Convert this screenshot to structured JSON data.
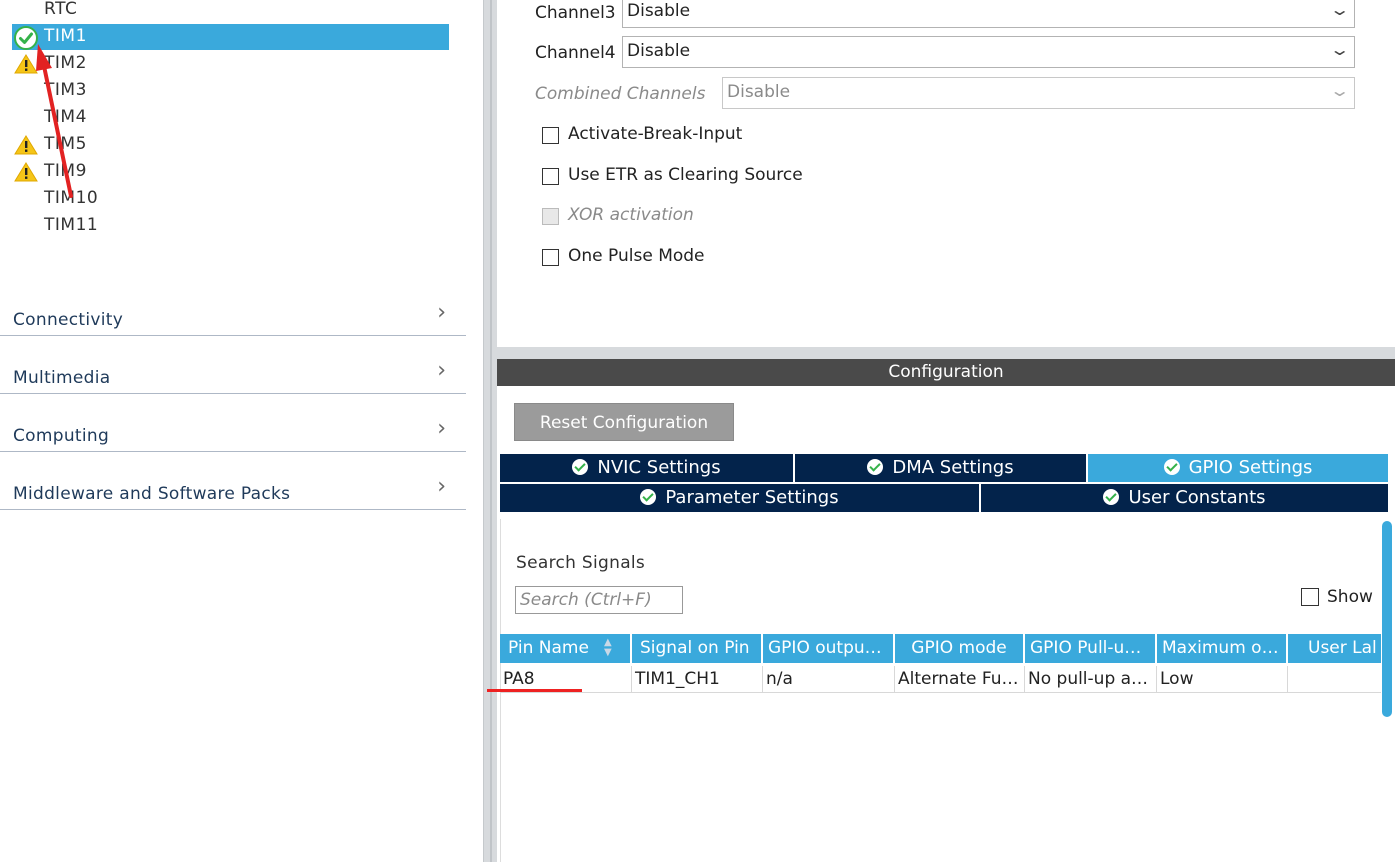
{
  "left_panel": {
    "timers": [
      {
        "label": "RTC",
        "status": "none"
      },
      {
        "label": "TIM1",
        "status": "ok",
        "selected": true
      },
      {
        "label": "TIM2",
        "status": "warning"
      },
      {
        "label": "TIM3",
        "status": "none"
      },
      {
        "label": "TIM4",
        "status": "none"
      },
      {
        "label": "TIM5",
        "status": "warning"
      },
      {
        "label": "TIM9",
        "status": "warning"
      },
      {
        "label": "TIM10",
        "status": "none"
      },
      {
        "label": "TIM11",
        "status": "none"
      }
    ],
    "categories": [
      {
        "label": "Connectivity",
        "icon": "chevron-right-icon"
      },
      {
        "label": "Multimedia",
        "icon": "chevron-right-icon"
      },
      {
        "label": "Computing",
        "icon": "chevron-right-icon"
      },
      {
        "label": "Middleware and Software Packs",
        "icon": "chevron-right-icon"
      }
    ]
  },
  "mode": {
    "channel3": {
      "label": "Channel3",
      "value": "Disable"
    },
    "channel4": {
      "label": "Channel4",
      "value": "Disable"
    },
    "combined": {
      "label": "Combined Channels",
      "value": "Disable",
      "disabled": true
    },
    "checkboxes": [
      {
        "label": "Activate-Break-Input",
        "checked": false,
        "disabled": false
      },
      {
        "label": "Use ETR as Clearing Source",
        "checked": false,
        "disabled": false
      },
      {
        "label": "XOR activation",
        "checked": false,
        "disabled": true
      },
      {
        "label": "One Pulse Mode",
        "checked": false,
        "disabled": false
      }
    ]
  },
  "configuration": {
    "title": "Configuration",
    "reset_button": "Reset Configuration",
    "tabs_row1": [
      {
        "label": "NVIC Settings",
        "active": false
      },
      {
        "label": "DMA Settings",
        "active": false
      },
      {
        "label": "GPIO Settings",
        "active": true
      }
    ],
    "tabs_row2": [
      {
        "label": "Parameter Settings",
        "active": false
      },
      {
        "label": "User Constants",
        "active": false
      }
    ],
    "search": {
      "title": "Search Signals",
      "placeholder": "Search (Ctrl+F)",
      "show_label": "Show"
    },
    "table": {
      "headers": [
        "Pin Name",
        "Signal on Pin",
        "GPIO outpu…",
        "GPIO mode",
        "GPIO Pull-u…",
        "Maximum o…",
        "User Lal"
      ],
      "rows": [
        [
          "PA8",
          "TIM1_CH1",
          "n/a",
          "Alternate Fu…",
          "No pull-up a…",
          "Low",
          ""
        ]
      ]
    }
  },
  "colors": {
    "accent": "#3aa9dc",
    "tab_dark": "#03234b",
    "annotation_red": "#e22222",
    "warning_yellow": "#f5c518",
    "ok_green": "#35b24a"
  }
}
